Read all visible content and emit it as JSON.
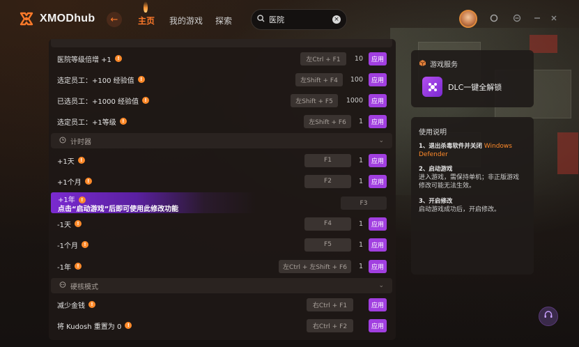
{
  "app": {
    "title": "XMODhub"
  },
  "nav": {
    "home": "主页",
    "my_games": "我的游戏",
    "explore": "探索"
  },
  "search": {
    "value": "医院"
  },
  "sections": {
    "timer": "计时器",
    "hardcore": "硬核模式"
  },
  "rows_top": [
    {
      "label": "医院等级倍增 +1",
      "hotkey": "左Ctrl + F1",
      "value": "10",
      "apply": "应用"
    },
    {
      "label": "选定员工：+100 经验值",
      "hotkey": "左Shift + F4",
      "value": "100",
      "apply": "应用"
    },
    {
      "label": "已选员工：+1000 经验值",
      "hotkey": "左Shift + F5",
      "value": "1000",
      "apply": "应用"
    },
    {
      "label": "选定员工：+1等级",
      "hotkey": "左Shift + F6",
      "value": "1",
      "apply": "应用"
    }
  ],
  "rows_timer": [
    {
      "label": "+1天",
      "hotkey": "F1",
      "value": "1",
      "apply": "应用"
    },
    {
      "label": "+1个月",
      "hotkey": "F2",
      "value": "1",
      "apply": "应用"
    }
  ],
  "promo": {
    "label": "+1年",
    "hotkey": "F3",
    "message": "点击“启动游戏”后即可使用此修改功能"
  },
  "rows_timer2": [
    {
      "label": "-1天",
      "hotkey": "F4",
      "value": "1",
      "apply": "应用"
    },
    {
      "label": "-1个月",
      "hotkey": "F5",
      "value": "1",
      "apply": "应用"
    },
    {
      "label": "-1年",
      "hotkey": "左Ctrl + 左Shift + F6",
      "value": "1",
      "apply": "应用"
    }
  ],
  "rows_hard": [
    {
      "label": "减少金钱",
      "hotkey": "右Ctrl + F1",
      "apply": "应用"
    },
    {
      "label": "将 Kudosh 重置为 0",
      "hotkey": "右Ctrl + F2",
      "apply": "应用"
    }
  ],
  "game_service": {
    "title": "游戏服务",
    "dlc": "DLC一键全解锁"
  },
  "instructions": {
    "title": "使用说明",
    "s1_title": "1、退出杀毒软件并关闭",
    "s1_hl": "Windows Defender",
    "s2_title": "2、启动游戏",
    "s2_body": "进入游戏，需保持单机；非正版游戏修改可能无法生效。",
    "s3_title": "3、开启修改",
    "s3_body": "启动游戏成功后，开启修改。"
  },
  "colors": {
    "accent": "#ff7a2a",
    "apply": "#a13fe0"
  }
}
